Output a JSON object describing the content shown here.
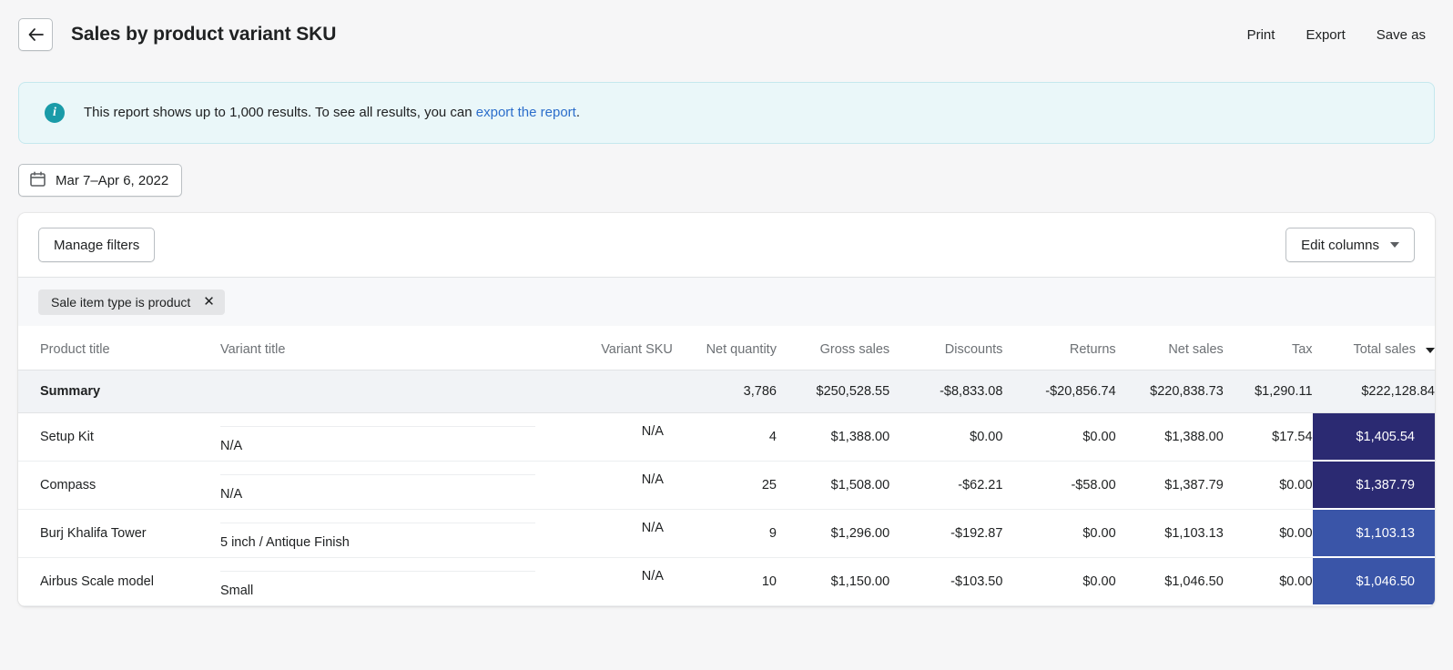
{
  "header": {
    "back_icon": "arrow-left-icon",
    "title": "Sales by product variant SKU",
    "actions": [
      {
        "label": "Print"
      },
      {
        "label": "Export"
      },
      {
        "label": "Save as"
      }
    ]
  },
  "banner": {
    "icon": "info-icon",
    "icon_glyph": "i",
    "text_before": "This report shows up to 1,000 results. To see all results, you can ",
    "link_text": "export the report",
    "text_after": ".",
    "background": "#eaf7f9",
    "icon_color": "#1a9ba8",
    "link_color": "#2c6ecb"
  },
  "date_filter": {
    "icon": "calendar-icon",
    "label": "Mar 7–Apr 6, 2022"
  },
  "toolbar": {
    "manage_filters_label": "Manage filters",
    "edit_columns_label": "Edit columns",
    "edit_columns_icon": "chevron-down-icon"
  },
  "applied_filters": [
    {
      "label": "Sale item type is product",
      "remove_icon": "close-icon",
      "remove_glyph": "✕"
    }
  ],
  "table": {
    "columns": [
      {
        "key": "product_title",
        "label": "Product title",
        "align": "left"
      },
      {
        "key": "variant_title",
        "label": "Variant title",
        "align": "left"
      },
      {
        "key": "variant_sku",
        "label": "Variant SKU",
        "align": "right"
      },
      {
        "key": "net_quantity",
        "label": "Net quantity",
        "align": "right"
      },
      {
        "key": "gross_sales",
        "label": "Gross sales",
        "align": "right"
      },
      {
        "key": "discounts",
        "label": "Discounts",
        "align": "right"
      },
      {
        "key": "returns",
        "label": "Returns",
        "align": "right"
      },
      {
        "key": "net_sales",
        "label": "Net sales",
        "align": "right"
      },
      {
        "key": "tax",
        "label": "Tax",
        "align": "right"
      },
      {
        "key": "total_sales",
        "label": "Total sales",
        "align": "right",
        "sorted": "desc",
        "sort_icon": "caret-down-icon"
      }
    ],
    "summary": {
      "label": "Summary",
      "variant_title": "",
      "variant_sku": "",
      "net_quantity": "3,786",
      "gross_sales": "$250,528.55",
      "discounts": "-$8,833.08",
      "returns": "-$20,856.74",
      "net_sales": "$220,838.73",
      "tax": "$1,290.11",
      "total_sales": "$222,128.84"
    },
    "rows": [
      {
        "product_title": "Setup Kit",
        "variant_title": "N/A",
        "variant_sku": "N/A",
        "net_quantity": "4",
        "gross_sales": "$1,388.00",
        "discounts": "$0.00",
        "returns": "$0.00",
        "net_sales": "$1,388.00",
        "tax": "$17.54",
        "total_sales": "$1,405.54",
        "heat_color": "#2b2a72"
      },
      {
        "product_title": "Compass",
        "variant_title": "N/A",
        "variant_sku": "N/A",
        "net_quantity": "25",
        "gross_sales": "$1,508.00",
        "discounts": "-$62.21",
        "returns": "-$58.00",
        "net_sales": "$1,387.79",
        "tax": "$0.00",
        "total_sales": "$1,387.79",
        "heat_color": "#2b2a72"
      },
      {
        "product_title": "Burj Khalifa Tower",
        "variant_title": "5 inch / Antique Finish",
        "variant_sku": "N/A",
        "net_quantity": "9",
        "gross_sales": "$1,296.00",
        "discounts": "-$192.87",
        "returns": "$0.00",
        "net_sales": "$1,103.13",
        "tax": "$0.00",
        "total_sales": "$1,103.13",
        "heat_color": "#3a55a8"
      },
      {
        "product_title": "Airbus Scale model",
        "variant_title": "Small",
        "variant_sku": "N/A",
        "net_quantity": "10",
        "gross_sales": "$1,150.00",
        "discounts": "-$103.50",
        "returns": "$0.00",
        "net_sales": "$1,046.50",
        "tax": "$0.00",
        "total_sales": "$1,046.50",
        "heat_color": "#3a55a8"
      }
    ]
  }
}
